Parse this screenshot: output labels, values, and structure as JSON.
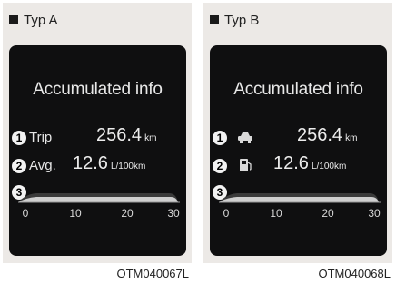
{
  "panels": [
    {
      "label": "Typ A",
      "screen": {
        "title": "Accumulated info",
        "rows": [
          {
            "number": "1",
            "label": "Trip",
            "icon": "",
            "value": "256.4",
            "unit": "km"
          },
          {
            "number": "2",
            "label": "Avg.",
            "icon": "",
            "value": "12.6",
            "unit": "L/100km"
          }
        ],
        "gauge": {
          "number": "3",
          "ticks": [
            "0",
            "10",
            "20",
            "30"
          ],
          "fill_fraction": 1.0
        }
      },
      "caption": "OTM040067L"
    },
    {
      "label": "Typ B",
      "screen": {
        "title": "Accumulated info",
        "rows": [
          {
            "number": "1",
            "label": "",
            "icon": "car-icon",
            "value": "256.4",
            "unit": "km"
          },
          {
            "number": "2",
            "label": "",
            "icon": "fuel-pump-icon",
            "value": "12.6",
            "unit": "L/100km"
          }
        ],
        "gauge": {
          "number": "3",
          "ticks": [
            "0",
            "10",
            "20",
            "30"
          ],
          "fill_fraction": 1.0
        }
      },
      "caption": "OTM040068L"
    }
  ],
  "colors": {
    "panel_background": "#ece9e6",
    "screen_background": "#0f0f10",
    "screen_text": "#e8e8e8",
    "gauge_fill": "#cfcfcf"
  }
}
